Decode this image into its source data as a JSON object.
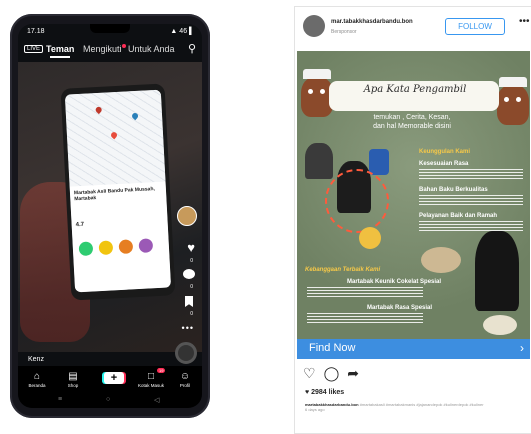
{
  "phone": {
    "status_time": "17.18",
    "status_icons": "▲ 46 ▌",
    "live_badge": "LIVE",
    "tabs": [
      {
        "label": "Teman",
        "active": true
      },
      {
        "label": "Mengikuti",
        "active": false
      },
      {
        "label": "Untuk Anda",
        "active": false
      }
    ],
    "search_icon": "search-icon",
    "map_card": {
      "place_name": "Martabak Asli Bandu Pak Mussah, Martabak",
      "rating": "4.7"
    },
    "rail": {
      "like_count": "0",
      "comment_count": "0",
      "bookmark_count": "0"
    },
    "username": "Kenz",
    "bottom_nav": [
      {
        "icon": "home-icon",
        "label": "Beranda"
      },
      {
        "icon": "shop-icon",
        "label": "Shop"
      },
      {
        "icon": "plus-icon",
        "label": ""
      },
      {
        "icon": "inbox-icon",
        "label": "Kotak Masuk",
        "badge": "19"
      },
      {
        "icon": "profile-icon",
        "label": "Profil"
      }
    ],
    "system_nav": [
      "≡",
      "○",
      "◁"
    ]
  },
  "post": {
    "username": "mar.tabakkhasdarbandu.bon",
    "sponsored": "Bersponsor",
    "follow_label": "FOLLOW",
    "ad": {
      "banner": "Apa Kata Pengambil",
      "subtitle": "temukan , Cerita, Kesan,\ndan hal Memorable disini",
      "section1": "Keunggulan Kami",
      "item1": "Kesesuaian Rasa",
      "item2": "Bahan Baku Berkualitas",
      "item3": "Pelayanan Baik dan Ramah",
      "section2": "Kebanggaan Terbaik Kami",
      "item4": "Martabak Keunik Cokelat Spesial",
      "item5": "Martabak Rasa Spesial"
    },
    "cta": "Find Now",
    "likes": "♥ 2984 likes",
    "caption_user": "martabakkhasdarbandu.bon",
    "caption_text": "#martabakasli #martabakmanis #jajanandepok #kulinerdepok #kuliner",
    "caption_time": "6 days ago"
  },
  "colors": {
    "tiktok_red": "#fe2c55",
    "tiktok_cyan": "#25f4ee",
    "ig_blue": "#3897f0",
    "cta_blue": "#3d8ee0"
  }
}
